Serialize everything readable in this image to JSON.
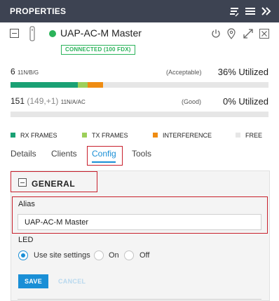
{
  "header": {
    "title": "PROPERTIES",
    "icons": [
      "clear-filter-icon",
      "menu-icon",
      "double-chevron-right-icon"
    ]
  },
  "device": {
    "name": "UAP-AC-M Master",
    "status": "CONNECTED (100 FDX)",
    "status_color": "#2bb35a",
    "actions": [
      "restart-icon",
      "locate-icon",
      "expand-icon",
      "close-icon"
    ]
  },
  "radios": [
    {
      "channel": "6",
      "band": "11N/B/G",
      "sub": "",
      "quality": "(Acceptable)",
      "utilization_label": "36% Utilized",
      "rx_fraction": 0.26,
      "tx_fraction": 0.04,
      "interference_fraction": 0.06
    },
    {
      "channel": "151",
      "band": "11N/A/AC",
      "sub": "(149,+1)",
      "quality": "(Good)",
      "utilization_label": "0% Utilized",
      "rx_fraction": 0,
      "tx_fraction": 0,
      "interference_fraction": 0
    }
  ],
  "legend": [
    {
      "label": "RX FRAMES",
      "color": "#1aa174"
    },
    {
      "label": "TX FRAMES",
      "color": "#9dcf5a"
    },
    {
      "label": "INTERFERENCE",
      "color": "#ef8c12"
    },
    {
      "label": "FREE",
      "color": "#e6e6e6"
    }
  ],
  "tabs": [
    {
      "label": "Details",
      "active": false
    },
    {
      "label": "Clients",
      "active": false
    },
    {
      "label": "Config",
      "active": true
    },
    {
      "label": "Tools",
      "active": false
    }
  ],
  "accent_color": "#1a8fd6",
  "general": {
    "title": "GENERAL",
    "alias_label": "Alias",
    "alias_value": "UAP-AC-M Master",
    "led_label": "LED",
    "led_options": [
      {
        "label": "Use site settings",
        "checked": true
      },
      {
        "label": "On",
        "checked": false
      },
      {
        "label": "Off",
        "checked": false
      }
    ],
    "save_label": "SAVE",
    "cancel_label": "CANCEL"
  }
}
